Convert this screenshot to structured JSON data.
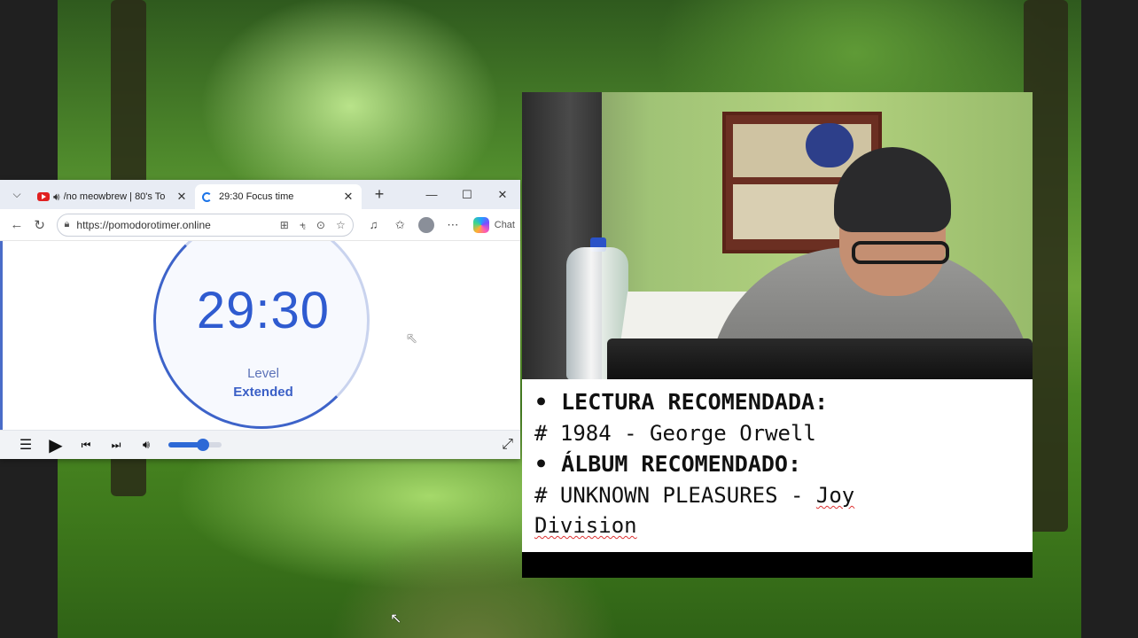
{
  "browser": {
    "tabs": [
      {
        "title": "/no meowbrew | 80's To",
        "icon": "youtube-icon",
        "audio": true,
        "active": false
      },
      {
        "title": "29:30 Focus time",
        "icon": "loading-icon",
        "audio": false,
        "active": true
      }
    ],
    "new_tab_label": "+",
    "url": "https://pomodorotimer.online",
    "copilot_label": "Chat"
  },
  "timer": {
    "time": "29:30",
    "level_label": "Level",
    "level_value": "Extended"
  },
  "player": {
    "volume_fraction": 0.65
  },
  "recommendations": {
    "reading_heading": "LECTURA RECOMENDADA:",
    "reading_item": "# 1984 - George Orwell",
    "album_heading": "ÁLBUM RECOMENDADO:",
    "album_item_part1": "# UNKNOWN PLEASURES - ",
    "album_item_part2": "Joy",
    "album_item_line2": "Division"
  },
  "colors": {
    "timer_blue": "#2f5bd0",
    "accent": "#2d69d6"
  }
}
